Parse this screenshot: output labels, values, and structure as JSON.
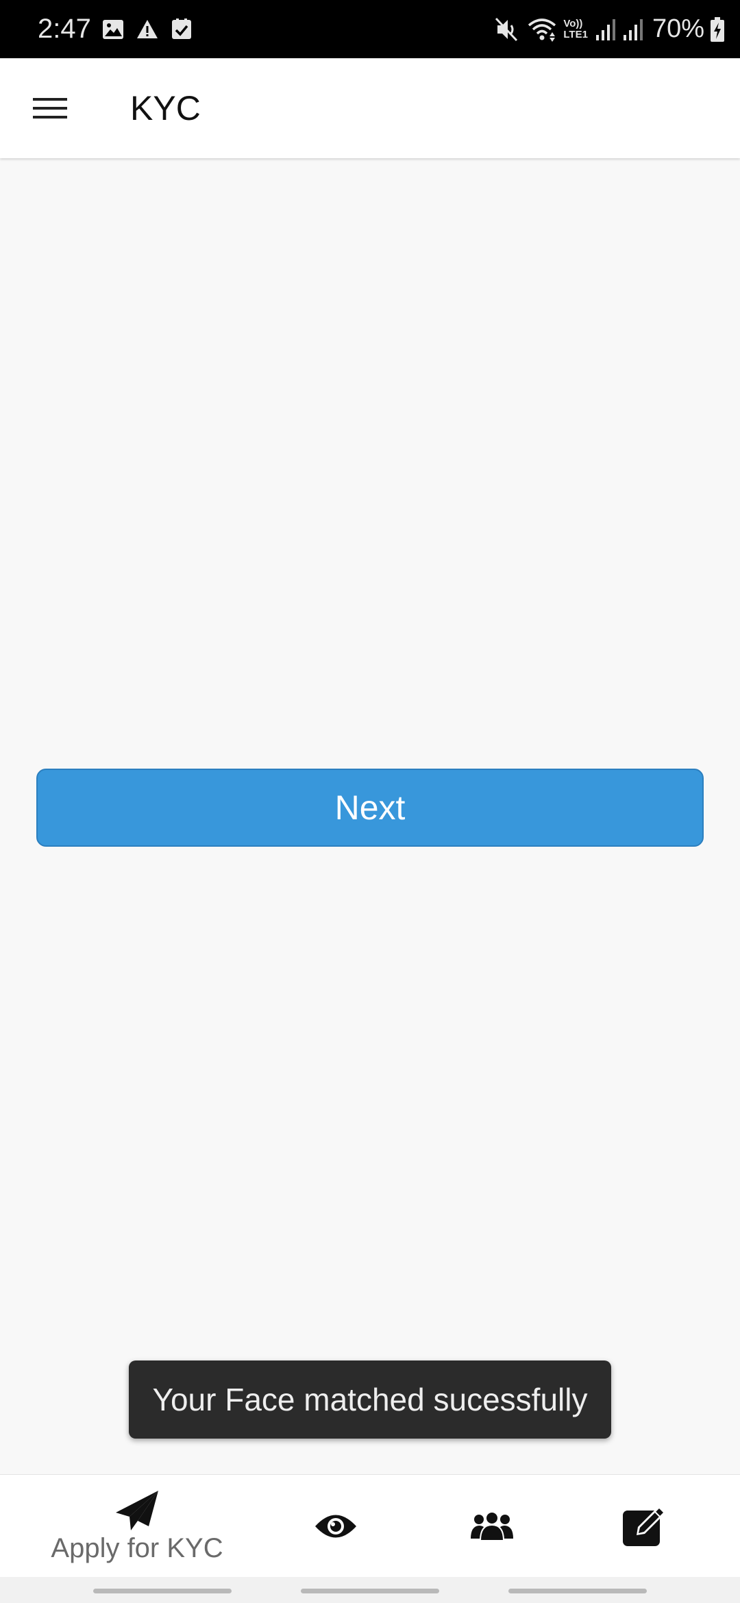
{
  "status_bar": {
    "time": "2:47",
    "left_icons": [
      "image-icon",
      "alert-icon",
      "checkbox-icon"
    ],
    "right_icons": [
      "mute-icon",
      "wifi-icon",
      "volte-icon",
      "signal-icon",
      "signal-icon",
      "battery-icon"
    ],
    "volte_label": "Vo))",
    "lte_label": "LTE1",
    "battery_percent": "70%"
  },
  "app_bar": {
    "title": "KYC",
    "menu_icon": "hamburger-icon"
  },
  "main": {
    "next_button_label": "Next"
  },
  "toast": {
    "message": "Your Face matched sucessfully"
  },
  "bottom_nav": {
    "items": [
      {
        "icon": "paper-plane-icon",
        "label": "Apply for KYC",
        "selected": true
      },
      {
        "icon": "eye-icon",
        "label": ""
      },
      {
        "icon": "group-icon",
        "label": ""
      },
      {
        "icon": "edit-icon",
        "label": ""
      }
    ]
  },
  "colors": {
    "status_bar_bg": "#000000",
    "app_bar_bg": "#ffffff",
    "background": "#f8f8f8",
    "primary_button": "#3897db",
    "toast_bg": "#2b2b2b"
  }
}
